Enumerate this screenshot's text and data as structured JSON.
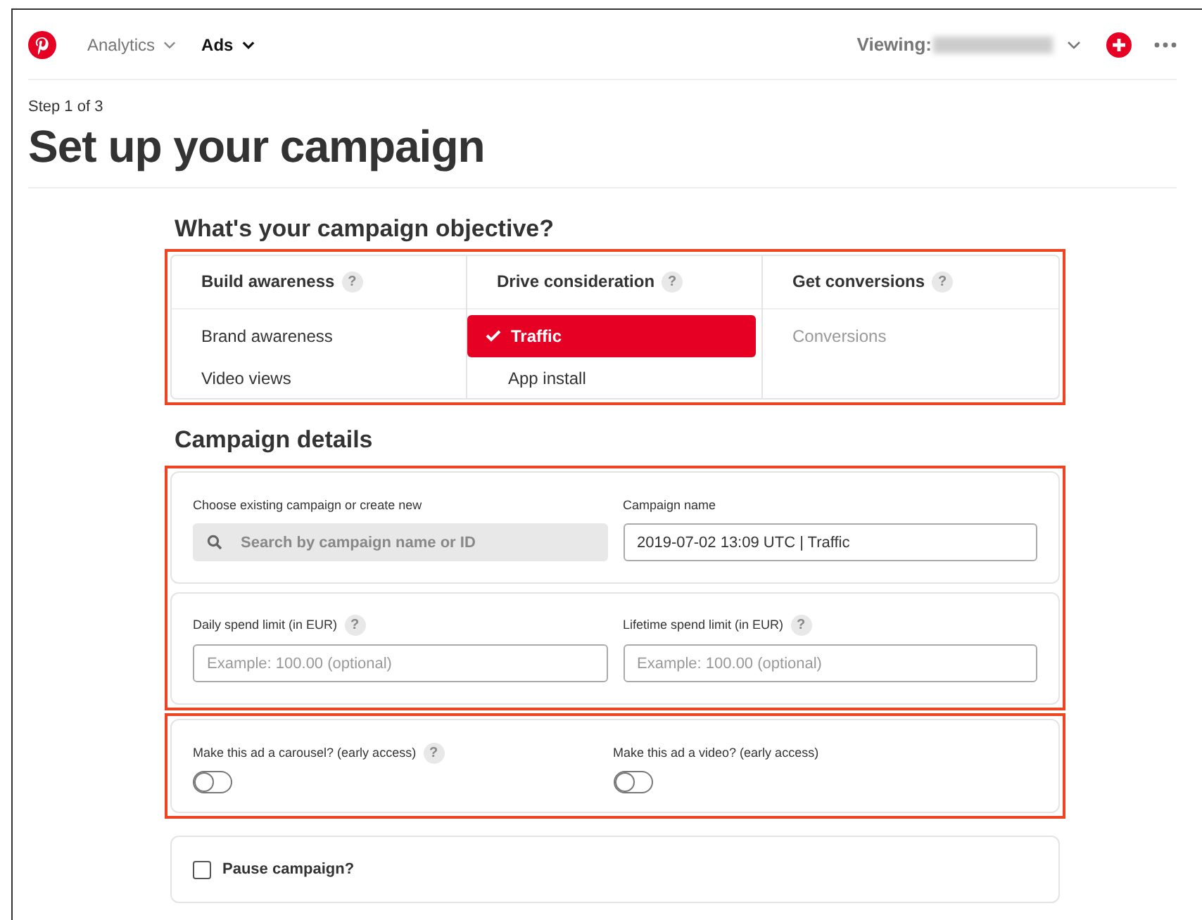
{
  "nav": {
    "items": [
      {
        "label": "Analytics",
        "selected": false
      },
      {
        "label": "Ads",
        "selected": true
      }
    ],
    "viewing_label": "Viewing:"
  },
  "step": "Step 1 of 3",
  "title": "Set up your campaign",
  "objective": {
    "heading": "What's your campaign objective?",
    "help": "?",
    "columns": [
      {
        "title": "Build awareness",
        "options": [
          {
            "label": "Brand awareness",
            "selected": false,
            "disabled": false
          },
          {
            "label": "Video views",
            "selected": false,
            "disabled": false
          }
        ]
      },
      {
        "title": "Drive consideration",
        "options": [
          {
            "label": "Traffic",
            "selected": true,
            "disabled": false
          },
          {
            "label": "App install",
            "selected": false,
            "disabled": false
          }
        ]
      },
      {
        "title": "Get conversions",
        "options": [
          {
            "label": "Conversions",
            "selected": false,
            "disabled": true
          }
        ]
      }
    ]
  },
  "details": {
    "heading": "Campaign details",
    "campaign_search": {
      "label": "Choose existing campaign or create new",
      "placeholder": "Search by campaign name or ID"
    },
    "campaign_name": {
      "label": "Campaign name",
      "value": "2019-07-02 13:09 UTC | Traffic"
    },
    "daily_limit": {
      "label": "Daily spend limit (in EUR)",
      "help": "?",
      "placeholder": "Example: 100.00 (optional)"
    },
    "lifetime_limit": {
      "label": "Lifetime spend limit (in EUR)",
      "help": "?",
      "placeholder": "Example: 100.00 (optional)"
    },
    "toggles": [
      {
        "label": "Make this ad a carousel? (early access)",
        "help": "?",
        "on": false
      },
      {
        "label": "Make this ad a video? (early access)",
        "on": false
      }
    ],
    "pause": {
      "label": "Pause campaign?",
      "checked": false
    }
  }
}
